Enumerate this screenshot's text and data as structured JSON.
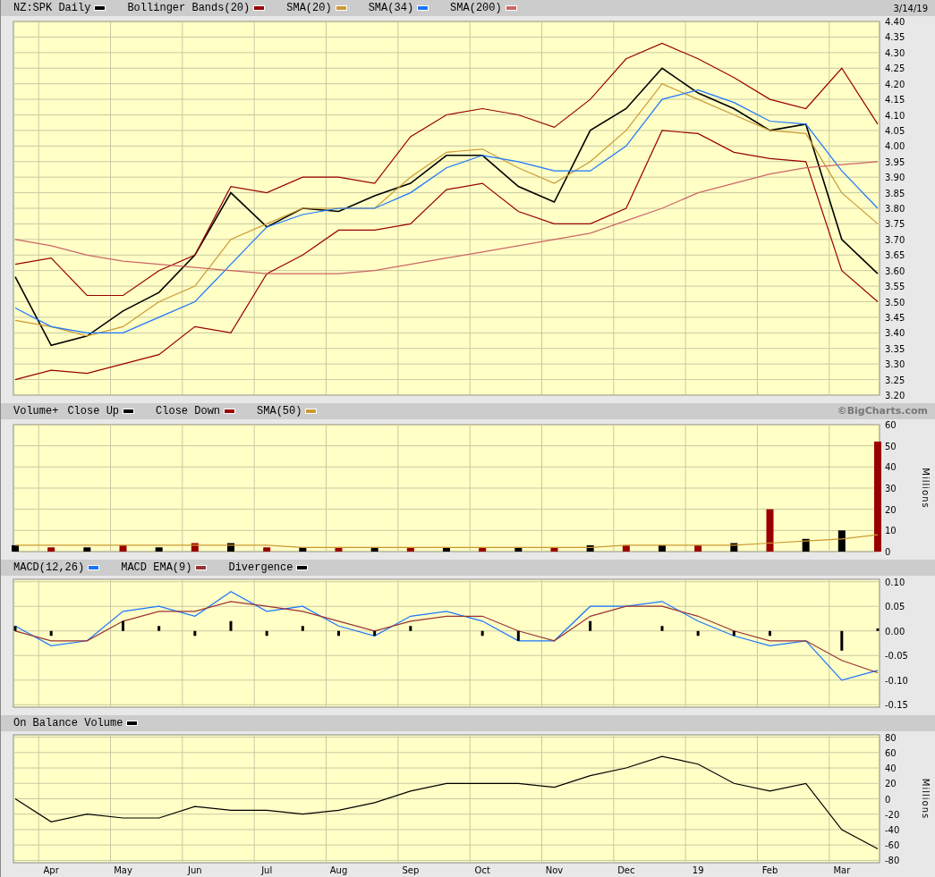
{
  "price_panel": {
    "date": "3/14/19",
    "chart_data": {
      "type": "line",
      "grid": true,
      "categories": [
        null,
        null,
        null,
        null,
        null,
        null,
        null,
        null,
        null,
        null,
        null,
        null,
        null,
        null,
        null,
        null,
        null,
        null,
        null,
        null,
        null,
        null,
        null,
        null,
        null
      ],
      "ylim": [
        3.2,
        4.4
      ],
      "yticks": [
        {
          "value": 4.4,
          "label": "4.40"
        },
        {
          "value": 4.35,
          "label": "4.35"
        },
        {
          "value": 4.3,
          "label": "4.30"
        },
        {
          "value": 4.25,
          "label": "4.25"
        },
        {
          "value": 4.2,
          "label": "4.20"
        },
        {
          "value": 4.15,
          "label": "4.15"
        },
        {
          "value": 4.1,
          "label": "4.10"
        },
        {
          "value": 4.05,
          "label": "4.05"
        },
        {
          "value": 4.0,
          "label": "4.00"
        },
        {
          "value": 3.95,
          "label": "3.95"
        },
        {
          "value": 3.9,
          "label": "3.90"
        },
        {
          "value": 3.85,
          "label": "3.85"
        },
        {
          "value": 3.8,
          "label": "3.80"
        },
        {
          "value": 3.75,
          "label": "3.75"
        },
        {
          "value": 3.7,
          "label": "3.70"
        },
        {
          "value": 3.65,
          "label": "3.65"
        },
        {
          "value": 3.6,
          "label": "3.60"
        },
        {
          "value": 3.55,
          "label": "3.55"
        },
        {
          "value": 3.5,
          "label": "3.50"
        },
        {
          "value": 3.45,
          "label": "3.45"
        },
        {
          "value": 3.4,
          "label": "3.40"
        },
        {
          "value": 3.35,
          "label": "3.35"
        },
        {
          "value": 3.3,
          "label": "3.30"
        },
        {
          "value": 3.25,
          "label": "3.25"
        },
        {
          "value": 3.2,
          "label": "3.20"
        }
      ],
      "series": [
        {
          "name": "NZ:SPK Daily",
          "color": "#000000",
          "values": [
            3.58,
            3.36,
            3.39,
            3.47,
            3.53,
            3.65,
            3.85,
            3.74,
            3.8,
            3.79,
            3.84,
            3.88,
            3.97,
            3.97,
            3.87,
            3.82,
            4.05,
            4.12,
            4.25,
            4.17,
            4.12,
            4.05,
            4.07,
            3.7,
            3.59
          ]
        },
        {
          "name": "Bollinger Bands(20)",
          "color": "#990000",
          "values": [
            3.62,
            3.64,
            3.52,
            3.52,
            3.6,
            3.65,
            3.87,
            3.85,
            3.9,
            3.9,
            3.88,
            4.03,
            4.1,
            4.12,
            4.1,
            4.06,
            4.15,
            4.28,
            4.33,
            4.28,
            4.22,
            4.15,
            4.12,
            4.25,
            4.07
          ]
        },
        {
          "color": "#990000",
          "values": [
            3.25,
            3.28,
            3.27,
            3.3,
            3.33,
            3.42,
            3.4,
            3.59,
            3.65,
            3.73,
            3.73,
            3.75,
            3.86,
            3.88,
            3.79,
            3.75,
            3.75,
            3.8,
            4.05,
            4.04,
            3.98,
            3.96,
            3.95,
            3.6,
            3.5
          ]
        },
        {
          "name": "SMA(20)",
          "color": "#cc9933",
          "values": [
            3.44,
            3.42,
            3.39,
            3.42,
            3.5,
            3.55,
            3.7,
            3.75,
            3.8,
            3.8,
            3.8,
            3.9,
            3.98,
            3.99,
            3.93,
            3.88,
            3.95,
            4.05,
            4.2,
            4.15,
            4.1,
            4.05,
            4.04,
            3.85,
            3.75
          ]
        },
        {
          "name": "SMA(34)",
          "color": "#1a75ff",
          "values": [
            3.48,
            3.42,
            3.4,
            3.4,
            3.45,
            3.5,
            3.62,
            3.74,
            3.78,
            3.8,
            3.8,
            3.85,
            3.93,
            3.97,
            3.95,
            3.92,
            3.92,
            4.0,
            4.15,
            4.18,
            4.14,
            4.08,
            4.07,
            3.92,
            3.8
          ]
        },
        {
          "name": "SMA(200)",
          "color": "#cc6666",
          "values": [
            3.7,
            3.68,
            3.65,
            3.63,
            3.62,
            3.61,
            3.6,
            3.59,
            3.59,
            3.59,
            3.6,
            3.62,
            3.64,
            3.66,
            3.68,
            3.7,
            3.72,
            3.76,
            3.8,
            3.85,
            3.88,
            3.91,
            3.93,
            3.94,
            3.95
          ]
        }
      ]
    }
  },
  "volume_panel": {
    "title": "Volume+",
    "credit": "©BigCharts.com",
    "unit": "Millions",
    "chart_data": {
      "type": "bar",
      "grid": true,
      "categories": [
        null,
        null,
        null,
        null,
        null,
        null,
        null,
        null,
        null,
        null,
        null,
        null,
        null,
        null,
        null,
        null,
        null,
        null,
        null,
        null,
        null,
        null,
        null,
        null,
        null
      ],
      "ylim": [
        0,
        60
      ],
      "yticks": [
        0,
        10,
        20,
        30,
        40,
        50,
        60
      ],
      "series": [
        {
          "name": "Close Up",
          "color": "#000000",
          "values": [
            3,
            0,
            2,
            0,
            2,
            0,
            4,
            0,
            2,
            0,
            2,
            0,
            2,
            0,
            2,
            0,
            3,
            0,
            3,
            0,
            4,
            0,
            6,
            10,
            0
          ]
        },
        {
          "name": "Close Down",
          "color": "#990000",
          "values": [
            0,
            2,
            0,
            3,
            0,
            4,
            0,
            2,
            0,
            2,
            0,
            2,
            0,
            2,
            0,
            2,
            0,
            3,
            0,
            3,
            0,
            20,
            0,
            0,
            52
          ]
        },
        {
          "name": "SMA(50)",
          "type": "line",
          "color": "#cc9933",
          "values": [
            3,
            3,
            3,
            3,
            3,
            3,
            3,
            3,
            2,
            2,
            2,
            2,
            2,
            2,
            2,
            2,
            2,
            3,
            3,
            3,
            3,
            4,
            5,
            6,
            8
          ]
        }
      ]
    }
  },
  "macd_panel": {
    "chart_data": {
      "type": "line",
      "grid": true,
      "categories": [
        null,
        null,
        null,
        null,
        null,
        null,
        null,
        null,
        null,
        null,
        null,
        null,
        null,
        null,
        null,
        null,
        null,
        null,
        null,
        null,
        null,
        null,
        null,
        null,
        null
      ],
      "ylim": [
        -0.155,
        0.105
      ],
      "yticks": [
        {
          "value": 0.1,
          "label": "0.10"
        },
        {
          "value": 0.05,
          "label": "0.05"
        },
        {
          "value": 0,
          "label": "0.00"
        },
        {
          "value": -0.05,
          "label": "-0.05"
        },
        {
          "value": -0.1,
          "label": "-0.10"
        },
        {
          "value": -0.15,
          "label": "-0.15"
        }
      ],
      "series": [
        {
          "name": "MACD(12,26)",
          "color": "#1a75ff",
          "values": [
            0.01,
            -0.03,
            -0.02,
            0.04,
            0.05,
            0.03,
            0.08,
            0.04,
            0.05,
            0.01,
            -0.01,
            0.03,
            0.04,
            0.02,
            -0.02,
            -0.02,
            0.05,
            0.05,
            0.06,
            0.02,
            -0.01,
            -0.03,
            -0.02,
            -0.1,
            -0.08
          ]
        },
        {
          "name": "MACD EMA(9)",
          "color": "#993333",
          "values": [
            0.0,
            -0.02,
            -0.02,
            0.02,
            0.04,
            0.04,
            0.06,
            0.05,
            0.04,
            0.02,
            0.0,
            0.02,
            0.03,
            0.03,
            0.0,
            -0.02,
            0.03,
            0.05,
            0.05,
            0.03,
            0.0,
            -0.02,
            -0.02,
            -0.06,
            -0.085
          ]
        },
        {
          "name": "Divergence",
          "type": "bar",
          "color": "#000000",
          "values": [
            0.01,
            -0.01,
            0,
            0.02,
            0.01,
            -0.01,
            0.02,
            -0.01,
            0.01,
            -0.01,
            -0.01,
            0.01,
            0,
            -0.01,
            -0.02,
            0,
            0.02,
            0,
            0.01,
            -0.01,
            -0.01,
            -0.01,
            0,
            -0.04,
            0.005
          ]
        }
      ]
    }
  },
  "obv_panel": {
    "unit": "Millions",
    "chart_data": {
      "type": "line",
      "grid": true,
      "categories": [
        null,
        "Apr",
        null,
        "May",
        null,
        "Jun",
        null,
        "Jul",
        null,
        "Aug",
        null,
        "Sep",
        null,
        "Oct",
        null,
        "Nov",
        null,
        "Dec",
        null,
        "19",
        null,
        "Feb",
        null,
        "Mar",
        null
      ],
      "ylim": [
        -83,
        83
      ],
      "yticks": [
        80,
        60,
        40,
        20,
        0,
        -20,
        -40,
        -60,
        -80
      ],
      "series": [
        {
          "name": "On Balance Volume",
          "color": "#000000",
          "values": [
            0,
            -30,
            -20,
            -25,
            -25,
            -10,
            -15,
            -15,
            -20,
            -15,
            -5,
            10,
            20,
            20,
            20,
            15,
            30,
            40,
            55,
            45,
            20,
            10,
            20,
            -40,
            -65
          ]
        }
      ]
    }
  }
}
